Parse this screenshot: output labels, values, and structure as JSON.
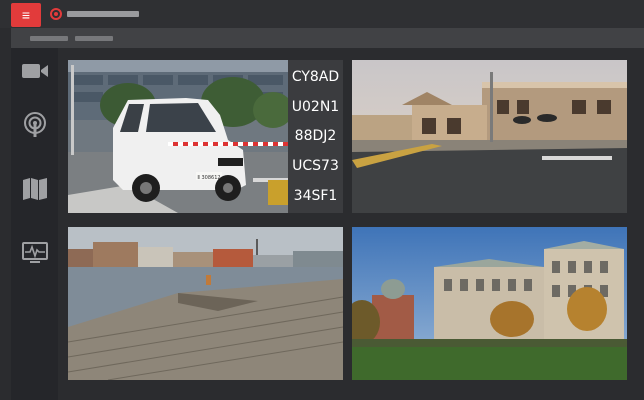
{
  "colors": {
    "accent": "#e23b3b",
    "topbar": "#2f3033",
    "sidebar": "#25262a",
    "subbar": "#414245",
    "icon": "#9fa0a3"
  },
  "header": {
    "menu_icon": "hamburger-icon",
    "logo_icon": "camera-logo-icon"
  },
  "sidebar": {
    "items": [
      {
        "icon": "video-camera-icon"
      },
      {
        "icon": "broadcast-icon"
      },
      {
        "icon": "map-icon"
      },
      {
        "icon": "monitor-pulse-icon"
      }
    ]
  },
  "plates": {
    "items": [
      "CY8AD",
      "U02N1",
      "88DJ2",
      "UCS73",
      "34SF1"
    ]
  },
  "vehicle": {
    "plate_text": "Ⅱ 308612"
  }
}
